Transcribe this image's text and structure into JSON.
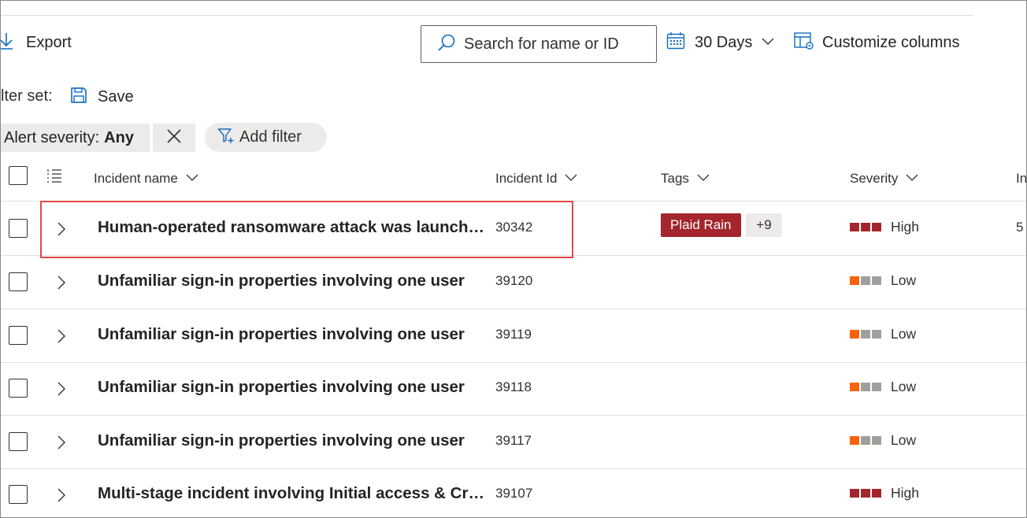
{
  "toolbar": {
    "export_label": "Export",
    "search_placeholder": "Search for name or ID",
    "date_range_label": "30 Days",
    "customize_label": "Customize columns"
  },
  "filter_set": {
    "label": "lter set:",
    "save_label": "Save"
  },
  "filters": {
    "severity_key": "Alert severity:",
    "severity_value": "Any",
    "add_filter_label": "Add filter"
  },
  "table": {
    "columns": {
      "incident_name": "Incident name",
      "incident_id": "Incident Id",
      "tags": "Tags",
      "severity": "Severity",
      "next_cut": "In"
    },
    "rows": [
      {
        "name": "Human-operated ransomware attack was launched from a compromised asset",
        "id": "30342",
        "tag": "Plaid Rain",
        "tag_more": "+9",
        "severity": "High",
        "extra": "5"
      },
      {
        "name": "Unfamiliar sign-in properties involving one user",
        "id": "39120",
        "severity": "Low"
      },
      {
        "name": "Unfamiliar sign-in properties involving one user",
        "id": "39119",
        "severity": "Low"
      },
      {
        "name": "Unfamiliar sign-in properties involving one user",
        "id": "39118",
        "severity": "Low"
      },
      {
        "name": "Unfamiliar sign-in properties involving one user",
        "id": "39117",
        "severity": "Low"
      },
      {
        "name": "Multi-stage incident involving Initial access & Credential access",
        "id": "39107",
        "severity": "High"
      }
    ]
  },
  "colors": {
    "severity_high": "#a4262c",
    "severity_low": "#f7630c",
    "severity_inactive": "#a19f9d",
    "tag_background": "#a4262c",
    "highlight_border": "#e0474c",
    "accent_icon": "#0f6cbd"
  }
}
